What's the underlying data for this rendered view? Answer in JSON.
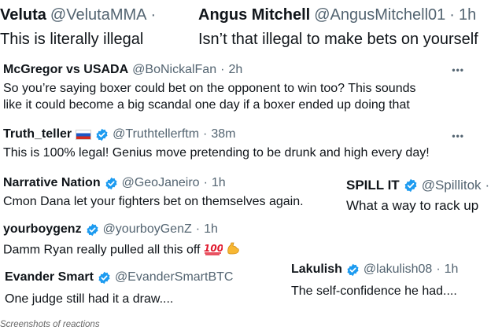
{
  "tweets": [
    {
      "name": "Veluta",
      "handle": "@VelutaMMA",
      "time": "",
      "sep": "·",
      "text": "This is literally illegal",
      "verified": false
    },
    {
      "name": "Angus Mitchell",
      "handle": "@AngusMitchell01",
      "time": "1h",
      "sep": "·",
      "text": "Isn’t that illegal to make bets on yourself",
      "verified": false
    },
    {
      "name": "McGregor vs USADA",
      "handle": "@BoNickalFan",
      "time": "2h",
      "sep": "·",
      "text": "So you’re saying boxer could bet on the opponent to win too? This sounds",
      "text2": "like it could become a big scandal one day if a boxer ended up doing that",
      "verified": false,
      "more": "•••"
    },
    {
      "name": "Truth_teller",
      "handle": "@Truthtellerftm",
      "time": "38m",
      "sep": "·",
      "text": "This is 100% legal! Genius move pretending to be drunk and high every day!",
      "verified": true,
      "flag": "russia-flag",
      "more": "•••"
    },
    {
      "name": "Narrative Nation",
      "handle": "@GeoJaneiro",
      "time": "1h",
      "sep": "·",
      "text": "Cmon Dana let your fighters bet on themselves again.",
      "verified": true
    },
    {
      "name": "SPILL IT",
      "handle": "@Spillitok",
      "time": "",
      "sep": "·",
      "text": "What a way to rack up",
      "verified": true
    },
    {
      "name": "yourboygenz",
      "handle": "@yourboyGenZ",
      "time": "1h",
      "sep": "·",
      "text": "Damm Ryan really pulled all this off",
      "emojis": [
        "hundred-points",
        "flexed-biceps"
      ],
      "verified": true
    },
    {
      "name": "Evander Smart",
      "handle": "@EvanderSmartBTC",
      "time": "",
      "sep": "",
      "text": "One judge still had it a draw....",
      "verified": true
    },
    {
      "name": "Lakulish",
      "handle": "@lakulish08",
      "time": "1h",
      "sep": "·",
      "text": "The self-confidence he had....",
      "verified": true
    }
  ],
  "caption": "Screenshots of reactions",
  "colors": {
    "name": "#0f1419",
    "meta": "#536471",
    "verified": "#1d9bf0"
  },
  "icons": {
    "verified": "verified-badge-icon",
    "more": "more-options-icon"
  }
}
